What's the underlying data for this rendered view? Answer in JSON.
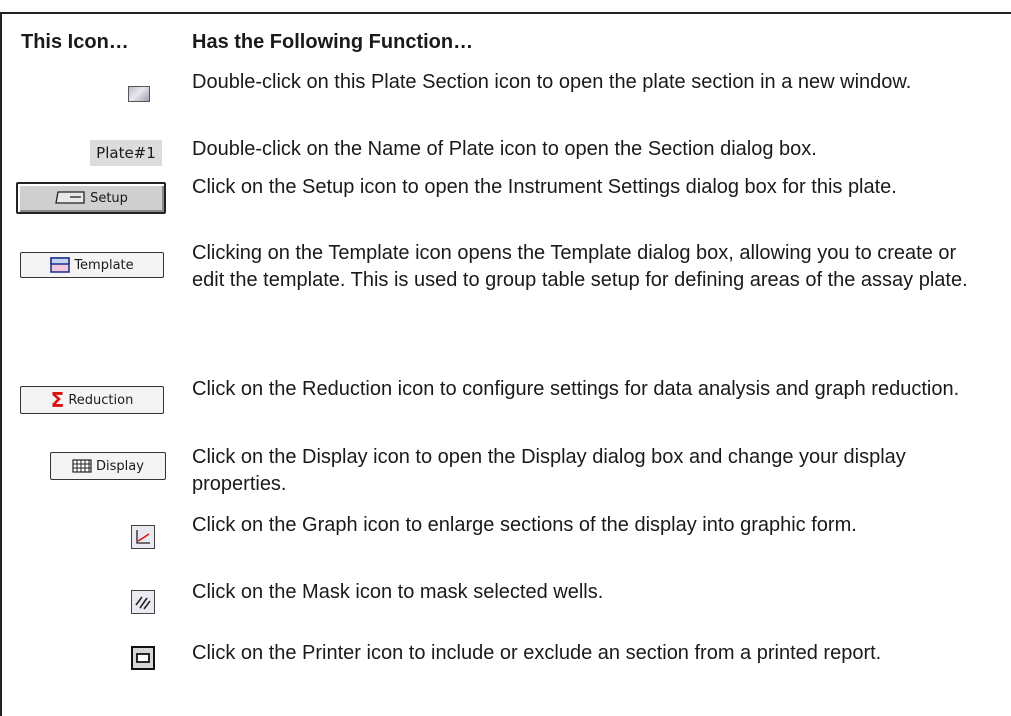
{
  "header": {
    "col_icon": "This Icon…",
    "col_function": "Has the Following Function…"
  },
  "rows": [
    {
      "icon_name": "plate-section-icon",
      "icon_label": "",
      "description": "Double-click on this Plate Section icon to open the plate section in a new window."
    },
    {
      "icon_name": "plate-name-icon",
      "icon_label": "Plate#1",
      "description": "Double-click on the Name of Plate icon to open the Section dialog box."
    },
    {
      "icon_name": "setup-icon",
      "icon_label": "Setup",
      "description": "Click on the Setup icon to open the Instrument Settings dialog box for this plate."
    },
    {
      "icon_name": "template-icon",
      "icon_label": "Template",
      "description": "Clicking on the Template icon opens the Template dialog box, allowing you to create or edit the template. This is used to group table setup for defining areas of the assay plate."
    },
    {
      "icon_name": "reduction-icon",
      "icon_label": "Reduction",
      "description": "Click on the Reduction icon to configure settings for data analysis and graph reduction."
    },
    {
      "icon_name": "display-icon",
      "icon_label": "Display",
      "description": "Click on the Display icon to open the Display dialog box and change your display properties."
    },
    {
      "icon_name": "graph-icon",
      "icon_label": "",
      "description": "Click on the Graph icon to enlarge sections of the display into graphic form."
    },
    {
      "icon_name": "mask-icon",
      "icon_label": "",
      "description": "Click on the Mask icon to mask selected wells."
    },
    {
      "icon_name": "printer-icon",
      "icon_label": "",
      "description": "Click on the Printer icon to include or exclude an section from a printed report."
    }
  ]
}
